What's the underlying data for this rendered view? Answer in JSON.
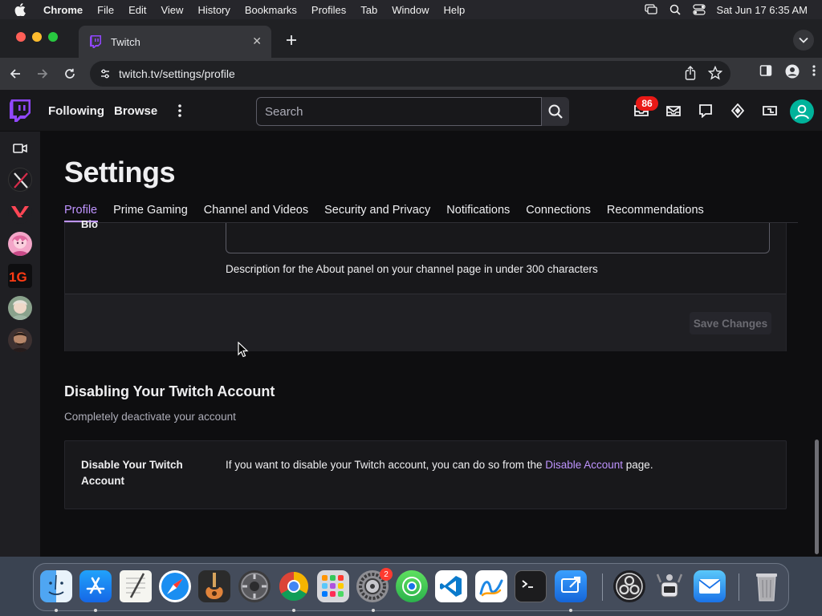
{
  "menubar": {
    "app_name": "Chrome",
    "menus": [
      "File",
      "Edit",
      "View",
      "History",
      "Bookmarks",
      "Profiles",
      "Tab",
      "Window",
      "Help"
    ],
    "datetime": "Sat Jun 17  6:35 AM"
  },
  "browser": {
    "tab_title": "Twitch",
    "url": "twitch.tv/settings/profile"
  },
  "twitch_header": {
    "nav_following": "Following",
    "nav_browse": "Browse",
    "search_placeholder": "Search",
    "notifications_count": "86"
  },
  "settings": {
    "title": "Settings",
    "tabs": [
      "Profile",
      "Prime Gaming",
      "Channel and Videos",
      "Security and Privacy",
      "Notifications",
      "Connections",
      "Recommendations"
    ],
    "active_tab": "Profile",
    "bio_label": "Bio",
    "bio_description": "Description for the About panel on your channel page in under 300 characters",
    "save_button": "Save Changes",
    "disable_section_title": "Disabling Your Twitch Account",
    "disable_section_subtitle": "Completely deactivate your account",
    "disable_label": "Disable Your Twitch Account",
    "disable_text_before": "If you want to disable your Twitch account, you can do so from the ",
    "disable_link": "Disable Account",
    "disable_text_after": " page."
  },
  "dock": {
    "apps": [
      "Finder",
      "App Store",
      "TextEdit",
      "Safari",
      "GarageBand",
      "Compressor",
      "Google Chrome",
      "Launchpad",
      "System Preferences",
      "Find My",
      "Visual Studio Code",
      "Freeform",
      "Terminal",
      "Screen Sharing",
      "OBS",
      "Automator",
      "Mail",
      "Trash"
    ],
    "system_prefs_badge": "2"
  },
  "colors": {
    "twitch_purple": "#9147ff",
    "link_purple": "#bf94ff",
    "notification_red": "#e91916"
  }
}
